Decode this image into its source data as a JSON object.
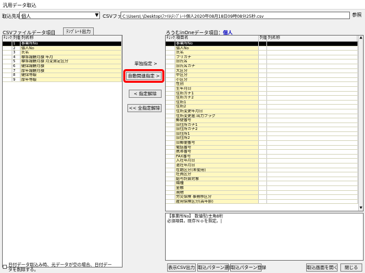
{
  "window": {
    "title": "汎用データ取込"
  },
  "top": {
    "target_label": "取込先項目",
    "target_value": "個人",
    "csv_label": "CSVファイル",
    "csv_path": "C:\\Users\\        \\Desktop\\ﾌｧｲﾙ\\ﾃﾝﾌﾟﾚｰﾄ個人2020年08月18日09時08分25秒.csv",
    "browse_label": "参照"
  },
  "left": {
    "title": "CSVファイルデータ項目",
    "template_button": "ﾃﾝﾌﾟﾚｰﾄ出力",
    "headers": [
      "ﾁｪｯｸ",
      "列番",
      "列名称"
    ],
    "rows": [
      {
        "check": "",
        "no": "1",
        "name": "事業所No",
        "selected": true
      },
      {
        "check": "",
        "no": "2",
        "name": "個人No"
      },
      {
        "check": "",
        "no": "3",
        "name": "氏名"
      },
      {
        "check": "",
        "no": "4",
        "name": "標準報酬月額 年月"
      },
      {
        "check": "",
        "no": "5",
        "name": "標準報酬月額 月変算定区分"
      },
      {
        "check": "",
        "no": "6",
        "name": "健保報酬月額"
      },
      {
        "check": "",
        "no": "7",
        "name": "厚年報酬月額"
      },
      {
        "check": "",
        "no": "8",
        "name": "健保等級"
      },
      {
        "check": "",
        "no": "9",
        "name": "厚年等級"
      }
    ]
  },
  "middle": {
    "single_assign": "単独指定 >",
    "auto_assign": "自動関連指定 >",
    "unassign": "< 指定解除",
    "unassign_all": "<< 全指定解除"
  },
  "right": {
    "title": "ろうむinOneデータ項目：",
    "title_target": "個人",
    "headers": [
      "ﾁｪｯｸ",
      "項目名",
      "列番",
      "列名称"
    ],
    "rows": [
      {
        "name": "事業所No",
        "selected": true
      },
      {
        "name": "個人No"
      },
      {
        "name": "氏名"
      },
      {
        "name": "フリガナ"
      },
      {
        "name": "旧氏名"
      },
      {
        "name": "旧氏名カナ"
      },
      {
        "name": "大区分"
      },
      {
        "name": "中区分"
      },
      {
        "name": "小区分"
      },
      {
        "name": "性別"
      },
      {
        "name": "生年月日"
      },
      {
        "name": "住所カナ1"
      },
      {
        "name": "住所カナ2"
      },
      {
        "name": "住所1"
      },
      {
        "name": "住所2"
      },
      {
        "name": "住所変更年月日"
      },
      {
        "name": "住所変更届 出力フラグ"
      },
      {
        "name": "郵便番号"
      },
      {
        "name": "旧住所カナ1"
      },
      {
        "name": "旧住所カナ2"
      },
      {
        "name": "旧住所1"
      },
      {
        "name": "旧住所2"
      },
      {
        "name": "旧郵便番号"
      },
      {
        "name": "電話番号"
      },
      {
        "name": "携帯番号"
      },
      {
        "name": "FAX番号"
      },
      {
        "name": "入社年月日"
      },
      {
        "name": "退社年月日"
      },
      {
        "name": "在籍区分(未使用)"
      },
      {
        "name": "社員区分"
      },
      {
        "name": "給与計算対象"
      },
      {
        "name": "職種"
      },
      {
        "name": "金融"
      },
      {
        "name": "現物"
      },
      {
        "name": "労災保険 事務移区分"
      },
      {
        "name": "雇用保険区分(高年齢)"
      }
    ],
    "memo_line1": "【事業所No】 数値型/主角8桁",
    "memo_line2": "必須項目。既存Ｎｏを指定。|"
  },
  "bottom": {
    "note_line1": "日付データ取込み時、元データが空の場合、日付デー",
    "note_line2": "タを削除する。",
    "btn_csv_out": "表示CSV出力",
    "btn_pattern_select": "取込パターン選択",
    "btn_pattern_register": "取込パターン登録",
    "btn_open_screen": "取込画面を開く",
    "btn_close": "閉じる"
  }
}
